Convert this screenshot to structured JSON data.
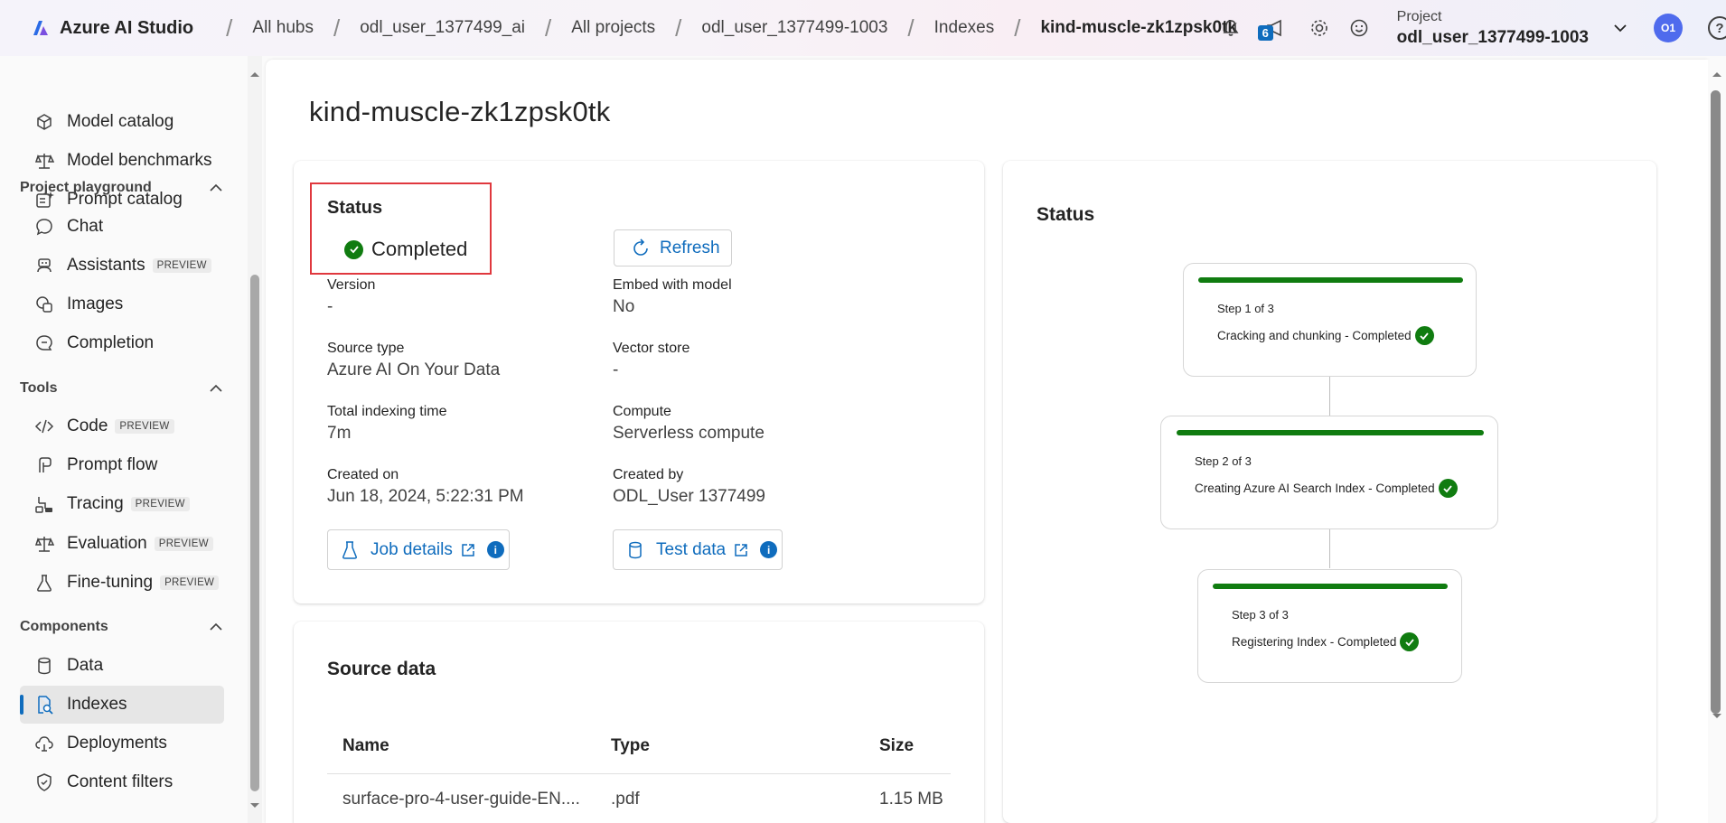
{
  "app": {
    "brand": "Azure AI Studio"
  },
  "breadcrumb": [
    "All hubs",
    "odl_user_1377499_ai",
    "All projects",
    "odl_user_1377499-1003",
    "Indexes",
    "kind-muscle-zk1zpsk0tk"
  ],
  "topbar": {
    "notification_badge": "6",
    "project_label": "Project",
    "project_name": "odl_user_1377499-1003",
    "avatar_initials": "O1",
    "help": "?"
  },
  "sidebar": {
    "items_top": [
      {
        "label": "Model catalog",
        "icon": "cube-icon"
      },
      {
        "label": "Model benchmarks",
        "icon": "scale-icon"
      },
      {
        "label": "Prompt catalog",
        "icon": "sparkle-doc-icon"
      }
    ],
    "sections": [
      {
        "title": "Project playground",
        "items": [
          {
            "label": "Chat",
            "icon": "chat-icon"
          },
          {
            "label": "Assistants",
            "icon": "bot-icon",
            "badge": "PREVIEW"
          },
          {
            "label": "Images",
            "icon": "image-icon"
          },
          {
            "label": "Completion",
            "icon": "completion-icon"
          }
        ]
      },
      {
        "title": "Tools",
        "items": [
          {
            "label": "Code",
            "icon": "code-icon",
            "badge": "PREVIEW"
          },
          {
            "label": "Prompt flow",
            "icon": "flow-icon"
          },
          {
            "label": "Tracing",
            "icon": "tracing-icon",
            "badge": "PREVIEW"
          },
          {
            "label": "Evaluation",
            "icon": "scale-icon",
            "badge": "PREVIEW"
          },
          {
            "label": "Fine-tuning",
            "icon": "flask-icon",
            "badge": "PREVIEW"
          }
        ]
      },
      {
        "title": "Components",
        "items": [
          {
            "label": "Data",
            "icon": "database-icon"
          },
          {
            "label": "Indexes",
            "icon": "index-icon",
            "active": true
          },
          {
            "label": "Deployments",
            "icon": "cloud-icon"
          },
          {
            "label": "Content filters",
            "icon": "shield-icon"
          }
        ]
      }
    ]
  },
  "page": {
    "title": "kind-muscle-zk1zpsk0tk"
  },
  "details": {
    "status_label": "Status",
    "status_value": "Completed",
    "refresh_label": "Refresh",
    "version_label": "Version",
    "version_value": "-",
    "embed_label": "Embed with model",
    "embed_value": "No",
    "source_type_label": "Source type",
    "source_type_value": "Azure AI On Your Data",
    "vector_store_label": "Vector store",
    "vector_store_value": "-",
    "total_time_label": "Total indexing time",
    "total_time_value": "7m",
    "compute_label": "Compute",
    "compute_value": "Serverless compute",
    "created_on_label": "Created on",
    "created_on_value": "Jun 18, 2024, 5:22:31 PM",
    "created_by_label": "Created by",
    "created_by_value": "ODL_User 1377499",
    "job_details_label": "Job details",
    "test_data_label": "Test data"
  },
  "status_panel": {
    "title": "Status",
    "steps": [
      {
        "num": "Step 1 of 3",
        "text": "Cracking and chunking - Completed"
      },
      {
        "num": "Step 2 of 3",
        "text": "Creating Azure AI Search Index - Completed"
      },
      {
        "num": "Step 3 of 3",
        "text": "Registering Index - Completed"
      }
    ]
  },
  "source_data": {
    "title": "Source data",
    "columns": [
      "Name",
      "Type",
      "Size"
    ],
    "rows": [
      {
        "name": "surface-pro-4-user-guide-EN....",
        "type": ".pdf",
        "size": "1.15 MB"
      }
    ]
  },
  "colors": {
    "accent": "#0f6cbd",
    "success": "#107c10",
    "highlight": "#e0383e"
  }
}
